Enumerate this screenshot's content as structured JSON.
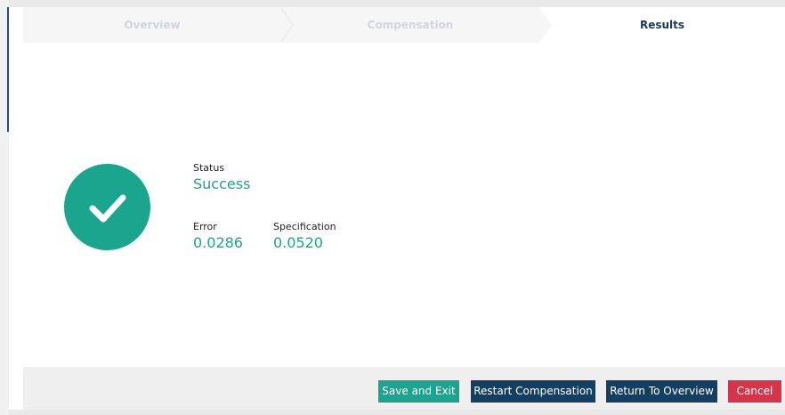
{
  "stepper": {
    "steps": [
      {
        "label": "Overview",
        "state": "completed"
      },
      {
        "label": "Compensation",
        "state": "completed"
      },
      {
        "label": "Results",
        "state": "active"
      }
    ]
  },
  "result": {
    "status_label": "Status",
    "status_value": "Success",
    "error_label": "Error",
    "error_value": "0.0286",
    "spec_label": "Specification",
    "spec_value": "0.0520",
    "icon": "checkmark-icon"
  },
  "footer": {
    "save_label": "Save and Exit",
    "restart_label": "Restart Compensation",
    "return_label": "Return To Overview",
    "cancel_label": "Cancel"
  },
  "colors": {
    "accent": "#1aa58e",
    "primary": "#133f63",
    "danger": "#d7344b"
  }
}
